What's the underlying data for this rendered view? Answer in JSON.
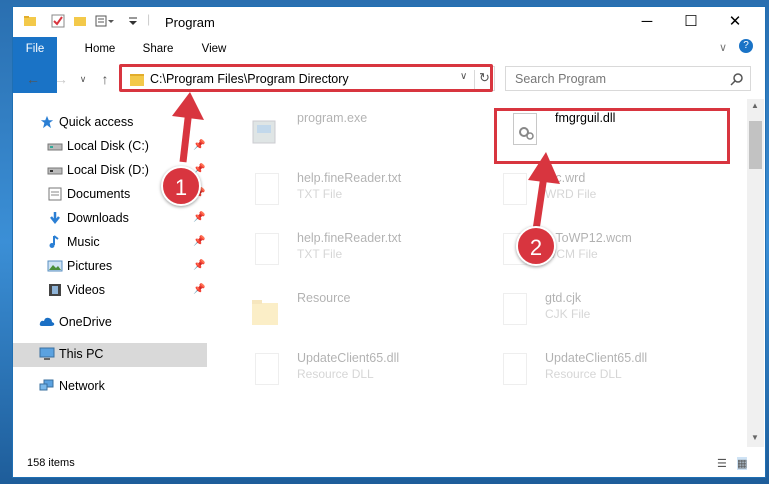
{
  "window": {
    "title": "Program"
  },
  "ribbon": {
    "tabs": [
      "File",
      "Home",
      "Share",
      "View"
    ]
  },
  "address": {
    "path": "C:\\Program Files\\Program Directory"
  },
  "search": {
    "placeholder": "Search Program"
  },
  "sidebar": {
    "items": [
      {
        "label": "Quick access",
        "icon": "star-icon"
      },
      {
        "label": "Local Disk (C:)",
        "icon": "drive-icon"
      },
      {
        "label": "Local Disk (D:)",
        "icon": "drive-icon"
      },
      {
        "label": "Documents",
        "icon": "documents-icon"
      },
      {
        "label": "Downloads",
        "icon": "download-icon"
      },
      {
        "label": "Music",
        "icon": "music-icon"
      },
      {
        "label": "Pictures",
        "icon": "pictures-icon"
      },
      {
        "label": "Videos",
        "icon": "videos-icon"
      },
      {
        "label": "OneDrive",
        "icon": "cloud-icon"
      },
      {
        "label": "This PC",
        "icon": "computer-icon"
      },
      {
        "label": "Network",
        "icon": "network-icon"
      }
    ]
  },
  "files": [
    {
      "name": "program.exe",
      "type": ""
    },
    {
      "name": "fmgrguil.dll",
      "type": ""
    },
    {
      "name": "help.fineReader.txt",
      "type": "TXT File"
    },
    {
      "name": "...c.wrd",
      "type": "WRD File"
    },
    {
      "name": "help.fineReader.txt",
      "type": "TXT File"
    },
    {
      "name": "...ToWP12.wcm",
      "type": "WCM File"
    },
    {
      "name": "Resource",
      "type": ""
    },
    {
      "name": "gtd.cjk",
      "type": "CJK File"
    },
    {
      "name": "UpdateClient65.dll",
      "type": "Resource DLL"
    },
    {
      "name": "UpdateClient65.dll",
      "type": "Resource DLL"
    }
  ],
  "status": {
    "count": "158 items"
  },
  "callouts": [
    "1",
    "2"
  ],
  "colors": {
    "accent": "#1a73c6",
    "highlight": "#d8353f",
    "folder": "#f3c94a"
  }
}
